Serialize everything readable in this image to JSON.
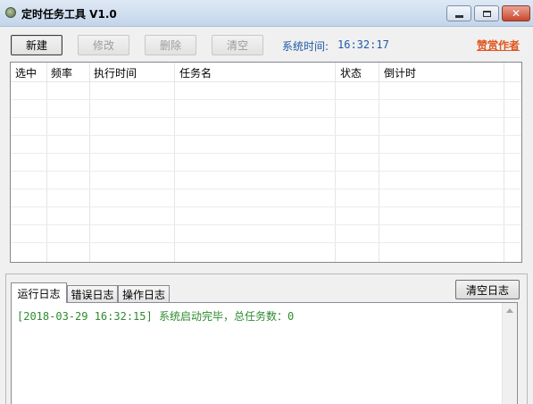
{
  "window": {
    "title": "定时任务工具 V1.0",
    "icon": "app-clock-icon",
    "controls": {
      "minimize": "minimize-icon",
      "maximize": "maximize-icon",
      "close": "✕"
    }
  },
  "toolbar": {
    "new_label": "新建",
    "edit_label": "修改",
    "delete_label": "删除",
    "clear_label": "清空",
    "system_time_label": "系统时间:",
    "system_time_value": "16:32:17",
    "author_link": "赞赏作者"
  },
  "task_table": {
    "columns": [
      "选中",
      "频率",
      "执行时间",
      "任务名",
      "状态",
      "倒计时"
    ],
    "rows": []
  },
  "log_panel": {
    "tabs": [
      {
        "label": "运行日志",
        "active": true
      },
      {
        "label": "错误日志",
        "active": false
      },
      {
        "label": "操作日志",
        "active": false
      }
    ],
    "clear_button": "清空日志",
    "entries": [
      "[2018-03-29 16:32:15] 系统启动完毕，总任务数：0"
    ]
  },
  "colors": {
    "time_text": "#1d5aa8",
    "author_link": "#e0561e",
    "log_text": "#2e8b2e"
  }
}
